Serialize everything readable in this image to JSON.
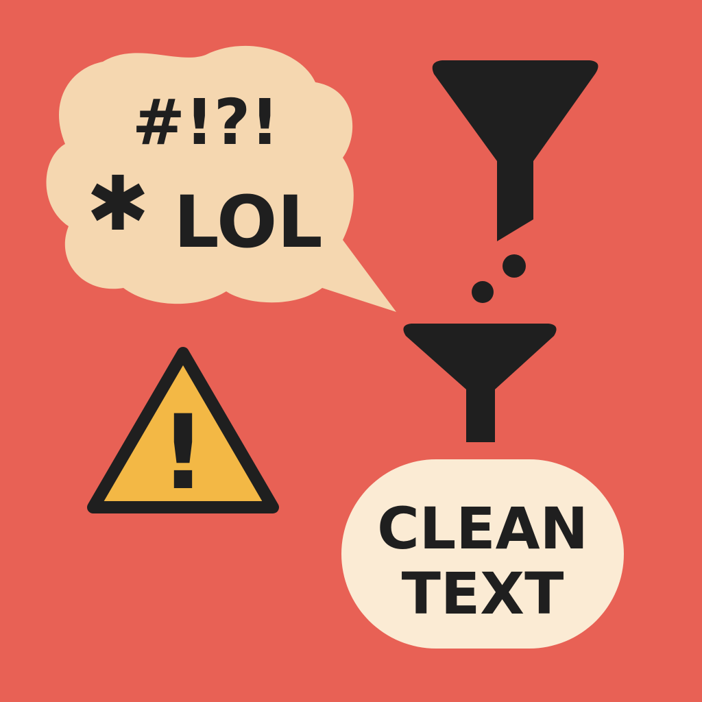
{
  "colors": {
    "background": "#E86155",
    "speech_bubble": "#F5D7B0",
    "ink": "#1F1F1F",
    "warning_fill": "#F3B845",
    "clean_bubble": "#FBEBD4"
  },
  "speech_bubble": {
    "line1": "#!?!",
    "line2_symbol": "✱",
    "line2_text": "LOL"
  },
  "warning": {
    "icon": "warning-triangle-icon",
    "symbol": "!"
  },
  "filter": {
    "icon": "funnel-icon"
  },
  "clean_text": {
    "line1": "CLEAN",
    "line2": "TEXT"
  }
}
